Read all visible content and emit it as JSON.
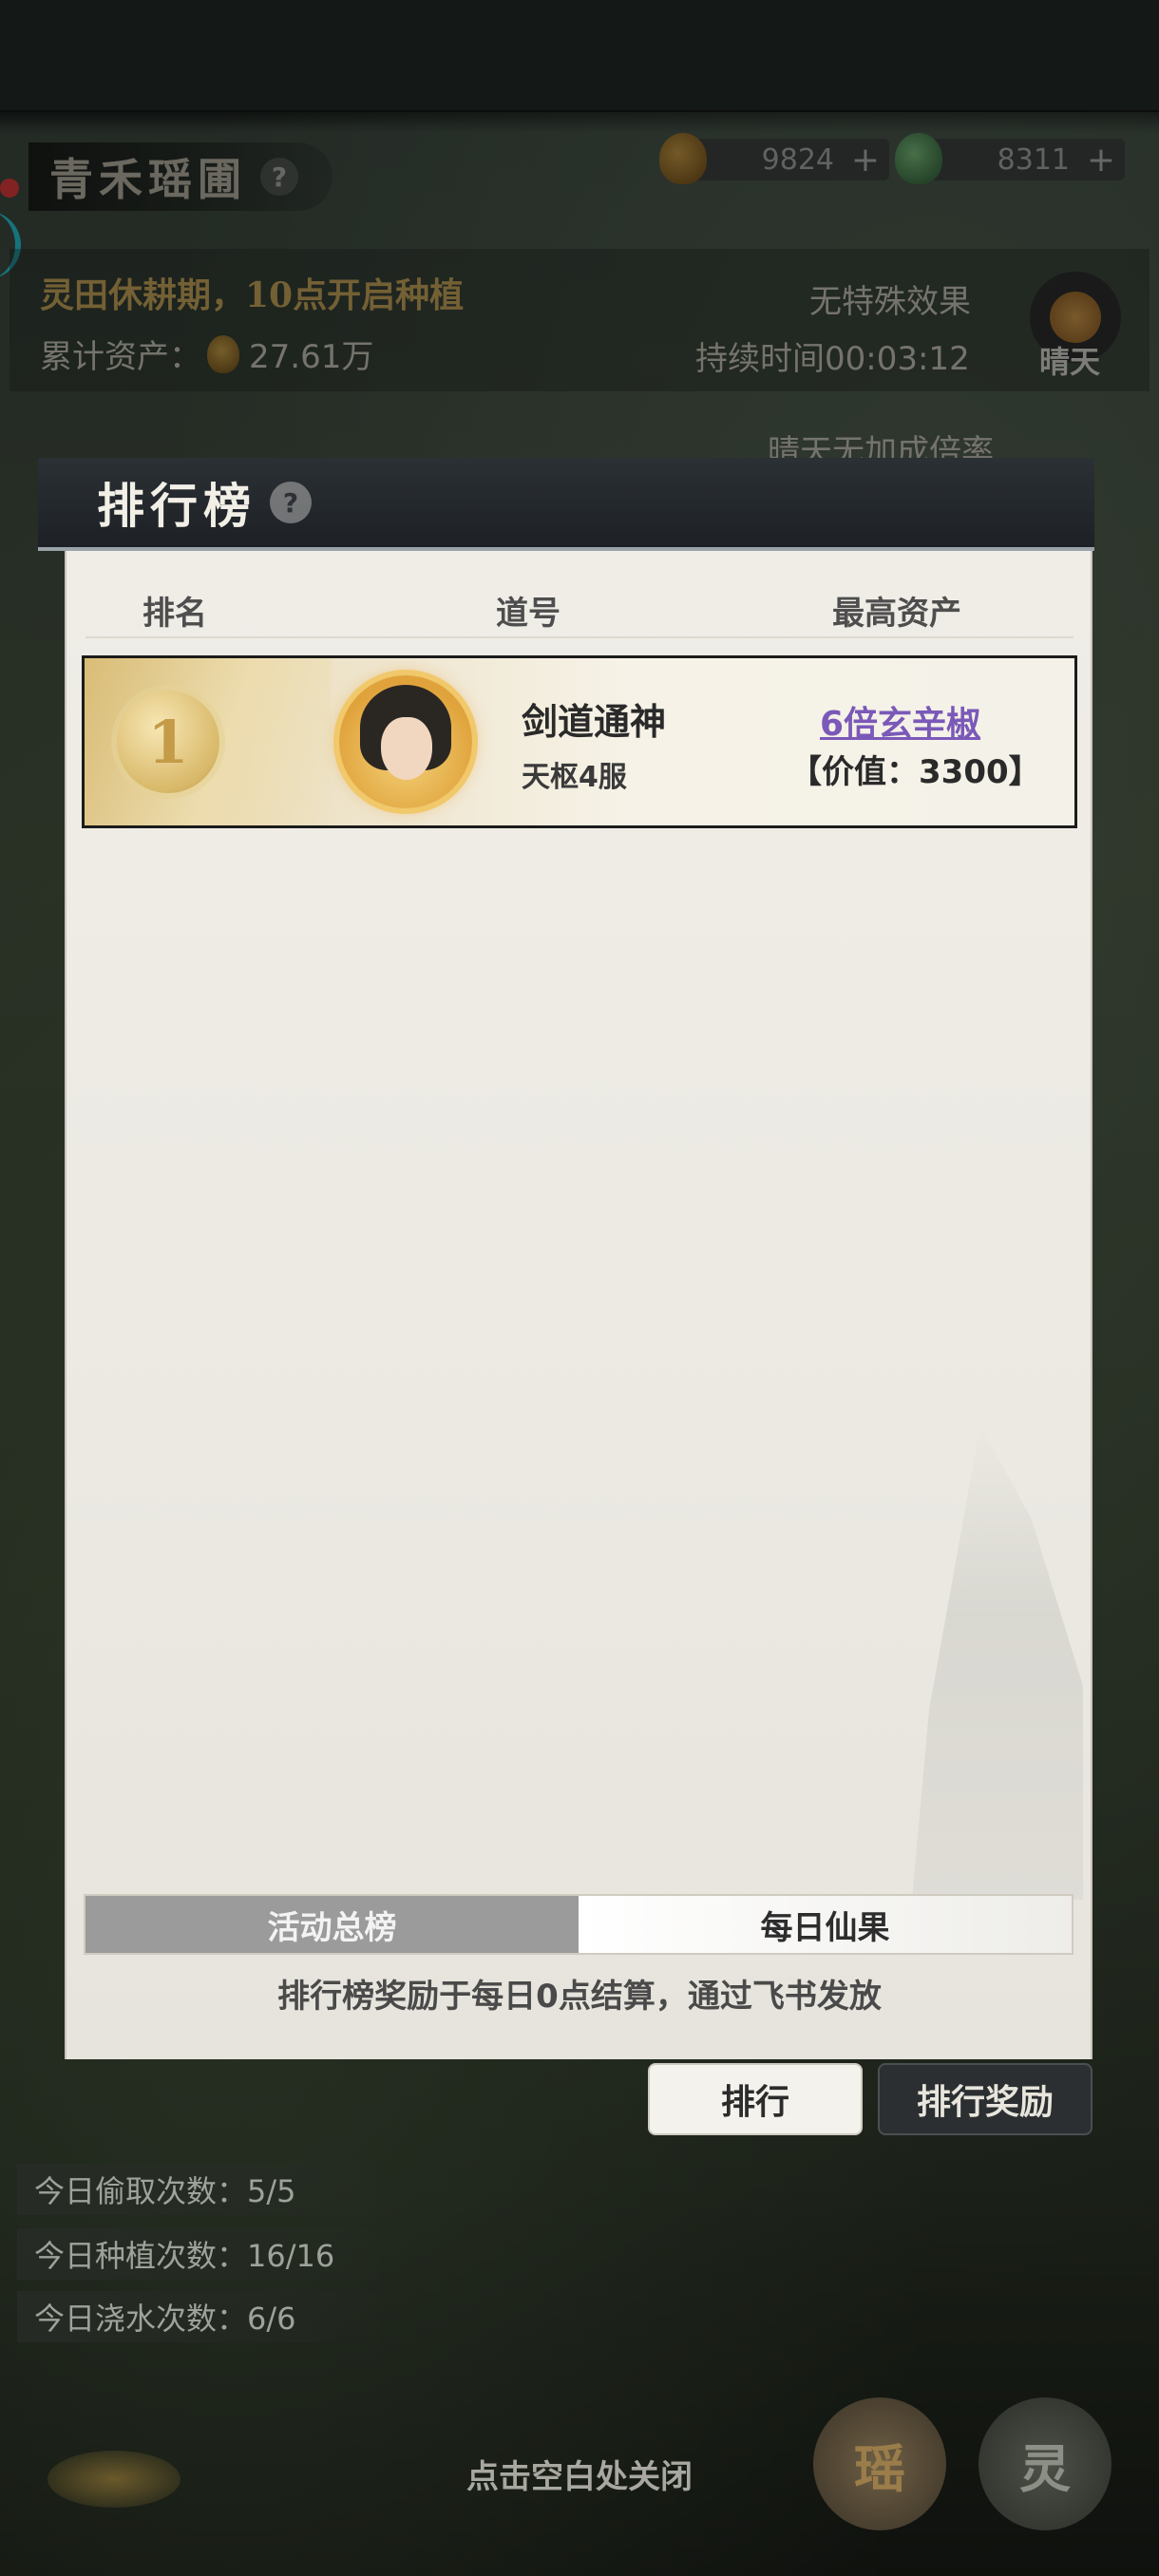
{
  "header": {
    "garden_title": "青禾瑶圃",
    "help": "?",
    "currencies": [
      {
        "icon": "gourd-coin-icon",
        "value": "9824",
        "plus": "+"
      },
      {
        "icon": "jade-icon",
        "value": "8311",
        "plus": "+"
      }
    ]
  },
  "status": {
    "season": "灵田休耕期，10点开启种植",
    "assets_label": "累计资产：",
    "assets_value": "27.61万",
    "effect": "无特殊效果",
    "duration": "持续时间00:03:12",
    "weather": "晴天",
    "weather_bonus": "晴天无加成倍率"
  },
  "leaderboard": {
    "title": "排行榜",
    "help": "?",
    "columns": {
      "rank": "排名",
      "name": "道号",
      "asset": "最高资产"
    },
    "rows": [
      {
        "rank": "1",
        "player": "剑道通神",
        "server": "天枢4服",
        "asset_name": "6倍玄辛椒",
        "asset_value": "【价值：3300】"
      }
    ],
    "tabs": [
      "活动总榜",
      "每日仙果"
    ],
    "active_tab": "每日仙果",
    "settle_note": "排行榜奖励于每日0点结算，通过飞书发放",
    "buttons": {
      "rank": "排行",
      "rewards": "排行奖励"
    }
  },
  "daily_stats": [
    "今日偷取次数：5/5",
    "今日种植次数：16/16",
    "今日浇水次数：6/6"
  ],
  "footer": {
    "close_hint": "点击空白处关闭",
    "garden_button": "瑶",
    "shop_button": "灵"
  },
  "colors": {
    "accent_gold": "#c7a55a",
    "link_purple": "#7a59b8",
    "active_tab": "#9b9b9b"
  }
}
